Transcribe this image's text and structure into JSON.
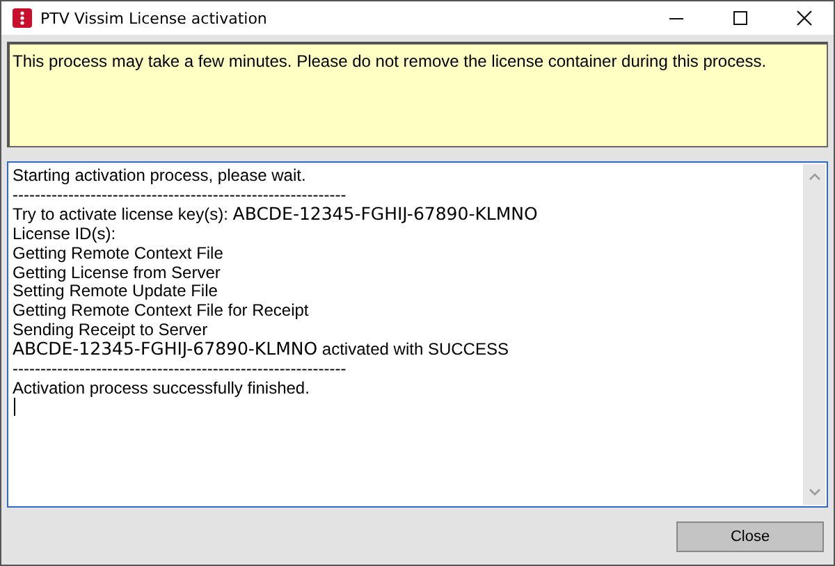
{
  "window": {
    "title": "PTV Vissim License activation"
  },
  "notice": "This process may take a few minutes. Please do not remove the license container during this process.",
  "log": [
    {
      "parts": [
        {
          "kind": "plain",
          "text": "Starting activation process, please wait."
        }
      ]
    },
    {
      "parts": [
        {
          "kind": "plain",
          "text": "------------------------------------------------------------"
        }
      ]
    },
    {
      "parts": [
        {
          "kind": "plain",
          "text": "Try to activate license key(s):  "
        },
        {
          "kind": "key",
          "text": "ABCDE-12345-FGHIJ-67890-KLMNO"
        }
      ]
    },
    {
      "parts": [
        {
          "kind": "plain",
          "text": "License ID(s):"
        }
      ]
    },
    {
      "parts": [
        {
          "kind": "plain",
          "text": "Getting Remote Context File"
        }
      ]
    },
    {
      "parts": [
        {
          "kind": "plain",
          "text": "Getting License from Server"
        }
      ]
    },
    {
      "parts": [
        {
          "kind": "plain",
          "text": "Setting Remote Update File"
        }
      ]
    },
    {
      "parts": [
        {
          "kind": "plain",
          "text": "Getting Remote Context File for Receipt"
        }
      ]
    },
    {
      "parts": [
        {
          "kind": "plain",
          "text": "Sending Receipt to Server"
        }
      ]
    },
    {
      "parts": [
        {
          "kind": "key",
          "text": "ABCDE-12345-FGHIJ-67890-KLMNO"
        },
        {
          "kind": "plain",
          "text": " activated with SUCCESS"
        }
      ]
    },
    {
      "parts": [
        {
          "kind": "plain",
          "text": "------------------------------------------------------------"
        }
      ]
    },
    {
      "parts": [
        {
          "kind": "plain",
          "text": "Activation process successfully finished."
        }
      ]
    }
  ],
  "buttons": [
    "Close"
  ]
}
